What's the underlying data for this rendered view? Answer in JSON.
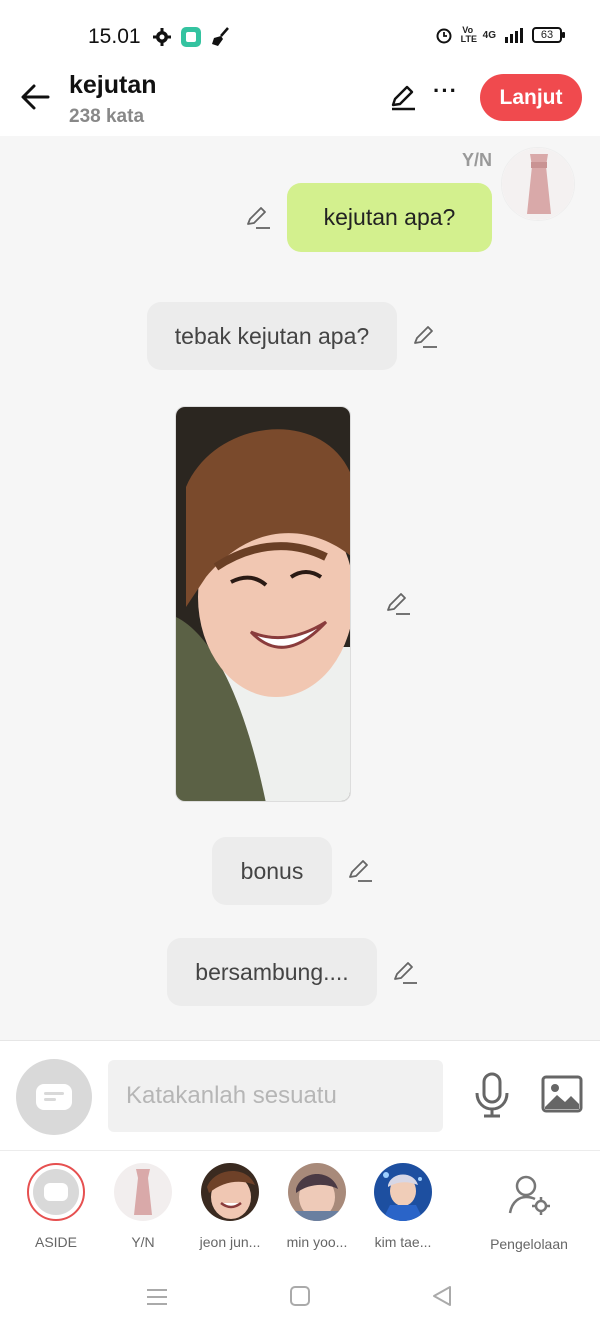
{
  "status": {
    "time": "15.01",
    "battery": "63",
    "network": "4G",
    "volte": "Vo LTE"
  },
  "header": {
    "title": "kejutan",
    "subtitle": "238 kata",
    "continue_label": "Lanjut"
  },
  "chat": {
    "speaker": "Y/N",
    "user_message": "kejutan  apa?",
    "narration": [
      "tebak kejutan apa?",
      "bonus",
      "bersambung...."
    ]
  },
  "composer": {
    "placeholder": "Katakanlah sesuatu"
  },
  "characters": [
    {
      "label": "ASIDE"
    },
    {
      "label": "Y/N"
    },
    {
      "label": "jeon jun..."
    },
    {
      "label": "min yoo..."
    },
    {
      "label": "kim tae..."
    }
  ],
  "manage_label": "Pengelolaan",
  "colors": {
    "accent": "#f04a4e",
    "user_bubble": "#d3f08e",
    "narration_bubble": "#ececec"
  },
  "icons": [
    "back-arrow-icon",
    "pencil-icon",
    "more-dots-icon",
    "microphone-icon",
    "image-icon",
    "user-settings-icon",
    "menu-icon",
    "home-icon",
    "back-triangle-icon",
    "settings-icon",
    "broom-icon",
    "alarm-icon",
    "signal-icon",
    "battery-icon"
  ]
}
